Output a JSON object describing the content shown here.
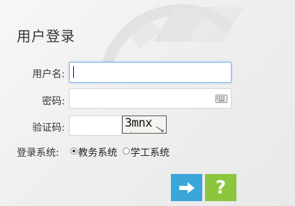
{
  "login": {
    "title": "用户登录",
    "username_label": "用户名:",
    "username_value": "",
    "password_label": "密码:",
    "password_value": "",
    "captcha_label": "验证码:",
    "captcha_value": "",
    "captcha_image_text": "3mnx",
    "system_label": "登录系统:",
    "system_options": [
      {
        "label": "教务系统",
        "selected": true
      },
      {
        "label": "学工系统",
        "selected": false
      }
    ],
    "login_button_icon": "arrow-right-icon",
    "help_button_text": "?"
  },
  "colors": {
    "login_button": "#3ba7d8",
    "help_button": "#8cc63f",
    "focused_border": "#7fb2f0"
  }
}
